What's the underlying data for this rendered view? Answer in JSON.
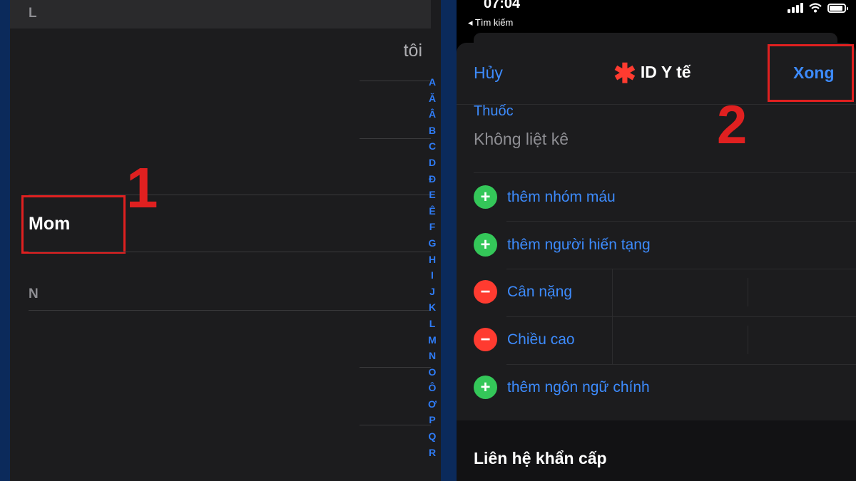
{
  "contacts": {
    "sections": [
      "L",
      "N"
    ],
    "me_label": "tôi",
    "highlighted_contact": "Mom",
    "step_marker": "1",
    "index_letters": [
      "A",
      "Ă",
      "Â",
      "B",
      "C",
      "D",
      "Đ",
      "E",
      "Ê",
      "F",
      "G",
      "H",
      "I",
      "J",
      "K",
      "L",
      "M",
      "N",
      "O",
      "Ô",
      "Ơ",
      "P",
      "Q",
      "R"
    ]
  },
  "status_bar": {
    "time": "07:04",
    "back_label": "◂ Tìm kiếm"
  },
  "medical_id": {
    "cancel_label": "Hủy",
    "title": "ID Y tế",
    "done_label": "Xong",
    "step_marker": "2",
    "medications_label": "Thuốc",
    "medications_value": "Không liệt kê",
    "rows": [
      {
        "type": "add",
        "label": "thêm nhóm máu"
      },
      {
        "type": "add",
        "label": "thêm người hiến tạng"
      },
      {
        "type": "remove",
        "label": "Cân nặng"
      },
      {
        "type": "remove",
        "label": "Chiều cao"
      },
      {
        "type": "add",
        "label": "thêm ngôn ngữ chính"
      }
    ],
    "emergency_contacts_label": "Liên hệ khẩn cấp"
  },
  "colors": {
    "accent_blue": "#3d8bfd",
    "highlight_red": "#e02020",
    "add_green": "#34c759",
    "remove_red": "#ff3b30"
  }
}
